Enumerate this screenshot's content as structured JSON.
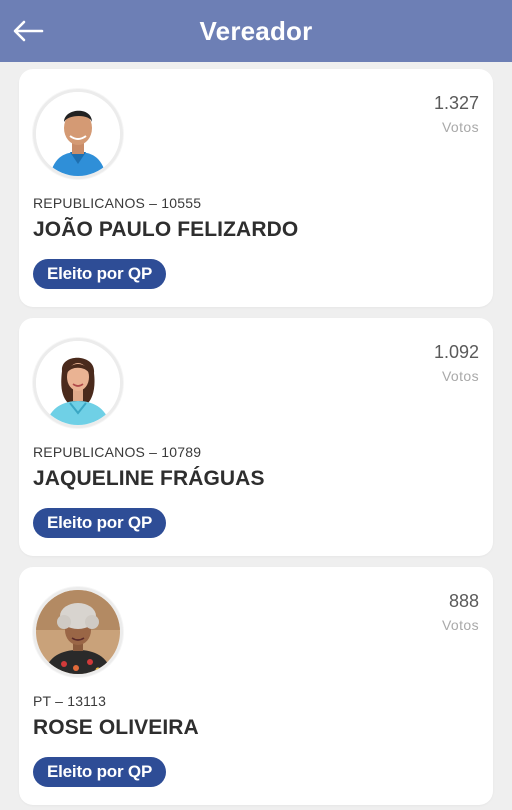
{
  "header": {
    "back_icon": "arrow-left-icon",
    "title": "Vereador",
    "background_color": "#6d7fb5"
  },
  "candidates": [
    {
      "votes": "1.327",
      "votes_label": "Votos",
      "party": "REPUBLICANOS – 10555",
      "name": "JOÃO PAULO FELIZARDO",
      "status": "Eleito por QP"
    },
    {
      "votes": "1.092",
      "votes_label": "Votos",
      "party": "REPUBLICANOS – 10789",
      "name": "JAQUELINE FRÁGUAS",
      "status": "Eleito por QP"
    },
    {
      "votes": "888",
      "votes_label": "Votos",
      "party": "PT – 13113",
      "name": "ROSE OLIVEIRA",
      "status": "Eleito por QP"
    }
  ],
  "colors": {
    "badge": "#2e4d96",
    "page_background": "#efefef",
    "card_background": "#ffffff"
  }
}
